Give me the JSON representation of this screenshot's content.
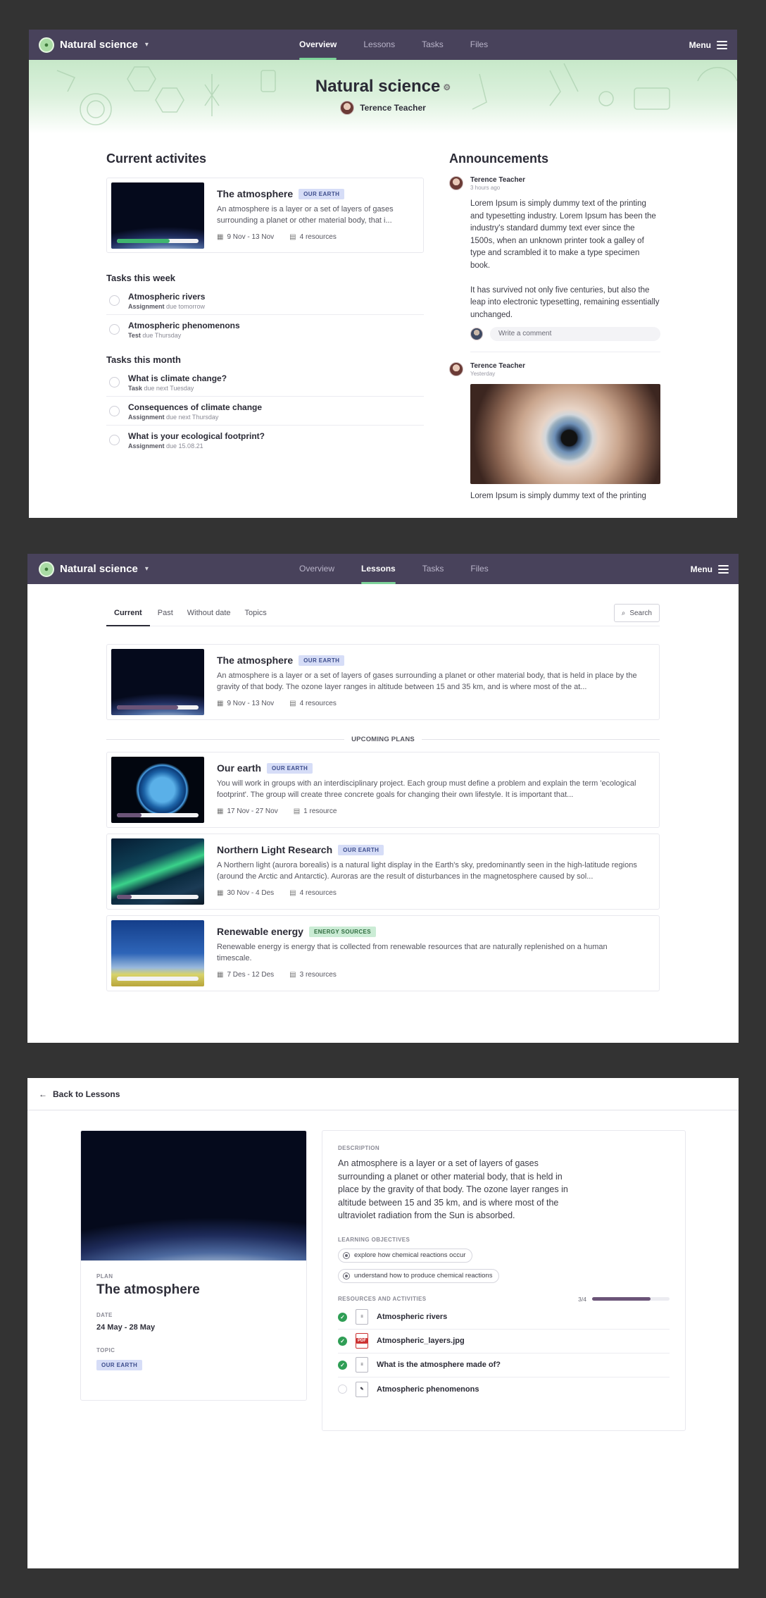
{
  "app": {
    "course_name": "Natural science",
    "nav": [
      "Overview",
      "Lessons",
      "Tasks",
      "Files"
    ],
    "menu_label": "Menu"
  },
  "overview": {
    "hero_title": "Natural science",
    "teacher_name": "Terence Teacher",
    "current_heading": "Current activites",
    "activity": {
      "title": "The atmosphere",
      "badge": "OUR EARTH",
      "desc": "An atmosphere is a layer or a set of layers of gases surrounding a planet or other material body, that i...",
      "date": "9 Nov - 13 Nov",
      "resources": "4 resources",
      "progress": 0.65
    },
    "week_heading": "Tasks this week",
    "week_tasks": [
      {
        "name": "Atmospheric rivers",
        "type": "Assignment",
        "due": "due tomorrow"
      },
      {
        "name": "Atmospheric phenomenons",
        "type": "Test",
        "due": "due Thursday"
      }
    ],
    "month_heading": "Tasks this month",
    "month_tasks": [
      {
        "name": "What is climate change?",
        "type": "Task",
        "due": "due next Tuesday"
      },
      {
        "name": "Consequences of climate change",
        "type": "Assignment",
        "due": "due next Thursday"
      },
      {
        "name": "What is your ecological footprint?",
        "type": "Assignment",
        "due": "due 15.08.21"
      }
    ],
    "announcements_heading": "Announcements",
    "announcements": [
      {
        "author": "Terence Teacher",
        "time": "3 hours ago",
        "p1": "Lorem Ipsum is simply dummy text of the printing and typesetting industry. Lorem Ipsum has been the industry's standard dummy text ever since the 1500s, when an unknown printer took a galley of type and scrambled it to make a type specimen book.",
        "p2": "It has survived not only five centuries, but also the leap into electronic typesetting, remaining essentially unchanged.",
        "comment_placeholder": "Write a comment"
      },
      {
        "author": "Terence Teacher",
        "time": "Yesterday",
        "p1": "Lorem Ipsum is simply dummy text of the printing"
      }
    ]
  },
  "lessons": {
    "subtabs": [
      "Current",
      "Past",
      "Without date",
      "Topics"
    ],
    "search_label": "Search",
    "current": {
      "title": "The atmosphere",
      "badge": "OUR EARTH",
      "desc": "An atmosphere is a layer or a set of layers of gases surrounding a planet or other material body, that is held in place by the gravity of that body. The ozone layer ranges in altitude between 15 and 35 km, and is where most of the at...",
      "date": "9 Nov - 13 Nov",
      "resources": "4 resources",
      "progress": 0.75
    },
    "upcoming_label": "UPCOMING PLANS",
    "upcoming": [
      {
        "title": "Our earth",
        "badge": "OUR EARTH",
        "desc": "You will work in groups with an interdisciplinary project. Each group must define a problem and explain the term 'ecological footprint'. The group will create three concrete goals for changing their own lifestyle. It is important that...",
        "date": "17 Nov - 27 Nov",
        "resources": "1 resource",
        "progress": 0.3
      },
      {
        "title": "Northern Light Research",
        "badge": "OUR EARTH",
        "desc": "A Northern light (aurora borealis) is a natural light display in the Earth's sky, predominantly seen in the high-latitude regions (around the Arctic and Antarctic). Auroras are the result of disturbances in the magnetosphere caused by sol...",
        "date": "30 Nov - 4 Des",
        "resources": "4 resources",
        "progress": 0.18
      },
      {
        "title": "Renewable energy",
        "badge": "ENERGY SOURCES",
        "desc": "Renewable energy is energy that is collected from renewable resources that are naturally replenished on a human timescale.",
        "date": "7 Des - 12 Des",
        "resources": "3 resources",
        "progress": 0
      }
    ]
  },
  "detail": {
    "back_label": "Back to Lessons",
    "plan_label": "PLAN",
    "title": "The atmosphere",
    "date_label": "DATE",
    "date": "24 May - 28 May",
    "topic_label": "TOPIC",
    "topic": "OUR EARTH",
    "desc_label": "DESCRIPTION",
    "desc": "An atmosphere is a layer or a set of layers of gases surrounding a planet or other material body, that is held in place by the gravity of that body. The ozone layer ranges in altitude between 15 and 35 km, and is where most of the ultraviolet radiation from the Sun is absorbed.",
    "objectives_label": "LEARNING OBJECTIVES",
    "objectives": [
      "explore how chemical reactions occur",
      "understand how to produce chemical reactions"
    ],
    "resources_label": "RESOURCES AND ACTIVITIES",
    "resources_count": "3/4",
    "resources_progress": 0.75,
    "resources": [
      {
        "name": "Atmospheric rivers",
        "done": true,
        "icon": "doc-icon"
      },
      {
        "name": "Atmospheric_layers.jpg",
        "done": true,
        "icon": "pdf-icon"
      },
      {
        "name": "What is the atmosphere made of?",
        "done": true,
        "icon": "doc-icon"
      },
      {
        "name": "Atmospheric phenomenons",
        "done": false,
        "icon": "quiz-icon"
      }
    ]
  },
  "colors": {
    "topbar": "#48425b",
    "active_tab": "#7ed39a",
    "progress_green": "#3fb56f",
    "progress_purple": "#6b5478",
    "badge_blue": "#d6ddf7",
    "badge_green": "#cbecd5"
  }
}
